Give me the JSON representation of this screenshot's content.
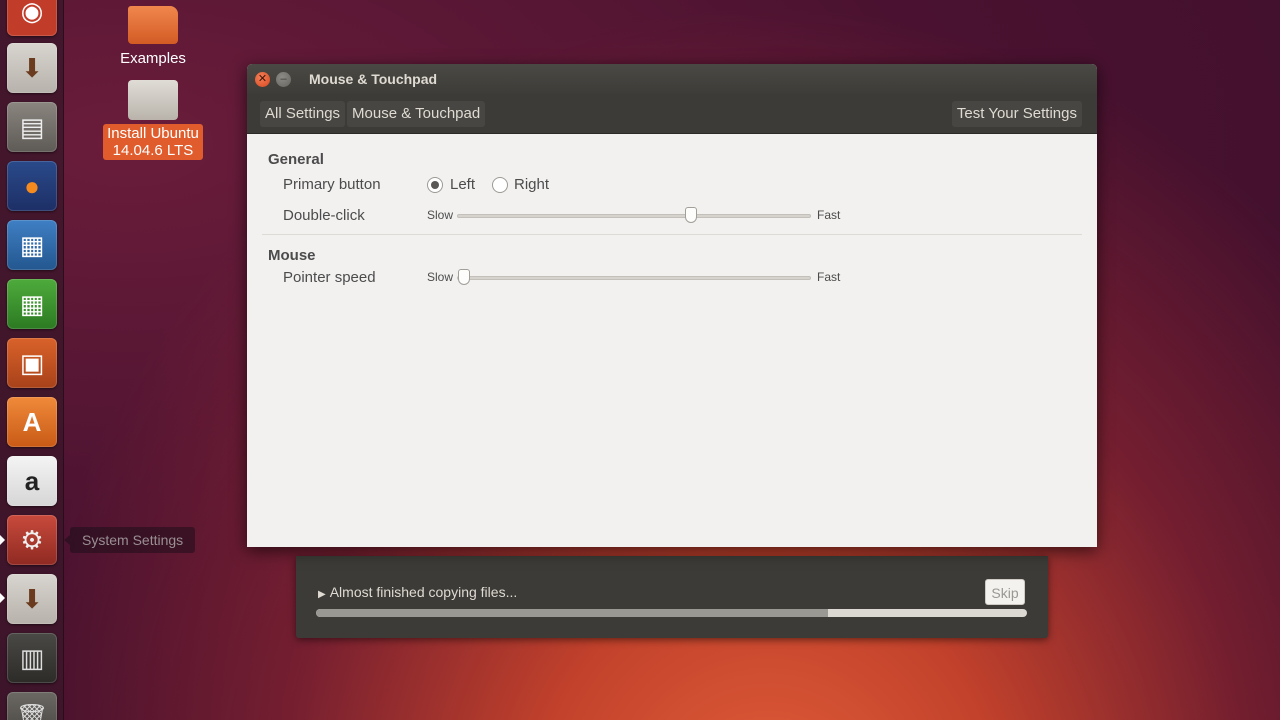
{
  "desktop": {
    "icons": [
      {
        "label": "Examples"
      },
      {
        "label_line1": "Install Ubuntu",
        "label_line2": "14.04.6 LTS"
      }
    ]
  },
  "launcher": {
    "items": [
      {
        "name": "dash-icon"
      },
      {
        "name": "ubuntu-installer-icon"
      },
      {
        "name": "files-icon"
      },
      {
        "name": "firefox-icon"
      },
      {
        "name": "libreoffice-writer-icon"
      },
      {
        "name": "libreoffice-calc-icon"
      },
      {
        "name": "libreoffice-impress-icon"
      },
      {
        "name": "software-center-icon"
      },
      {
        "name": "amazon-icon"
      },
      {
        "name": "system-settings-icon"
      },
      {
        "name": "ubuntu-installer-icon"
      },
      {
        "name": "disk-icon"
      },
      {
        "name": "trash-icon"
      }
    ],
    "tooltip": "System Settings"
  },
  "window": {
    "title": "Mouse & Touchpad",
    "toolbar": {
      "all_settings": "All Settings",
      "current": "Mouse & Touchpad",
      "test_settings": "Test Your Settings"
    },
    "general": {
      "title": "General",
      "primary_button_label": "Primary button",
      "left_label": "Left",
      "right_label": "Right",
      "selected": "Left",
      "double_click_label": "Double-click",
      "double_click_value": 0.66
    },
    "mouse": {
      "title": "Mouse",
      "pointer_speed_label": "Pointer speed",
      "pointer_speed_value": 0.02
    },
    "slow_label": "Slow",
    "fast_label": "Fast"
  },
  "installer": {
    "status": "Almost finished copying files...",
    "skip_label": "Skip",
    "progress": 0.72
  },
  "colors": {
    "accent": "#e05c2c",
    "window_dark": "#3c3b37",
    "window_light": "#f2f1f0"
  }
}
